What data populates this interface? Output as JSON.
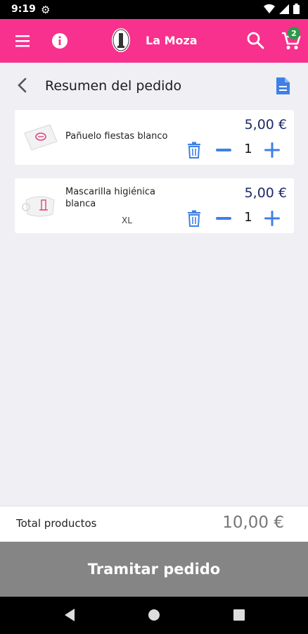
{
  "status_bar": {
    "time": "9:19"
  },
  "app_bar": {
    "brand": "La Moza",
    "cart_count": "2"
  },
  "header": {
    "title": "Resumen del pedido"
  },
  "items": [
    {
      "name": "Pañuelo fiestas blanco",
      "variant": "",
      "price": "5,00 €",
      "quantity": "1"
    },
    {
      "name": "Mascarilla higiénica blanca",
      "variant": "XL",
      "price": "5,00 €",
      "quantity": "1"
    }
  ],
  "totals": {
    "label": "Total productos",
    "value": "10,00 €"
  },
  "checkout": {
    "label": "Tramitar pedido"
  },
  "colors": {
    "brand": "#f7318d",
    "accent": "#3f80e6",
    "price": "#1f2a68",
    "badge": "#2c9a4a"
  }
}
